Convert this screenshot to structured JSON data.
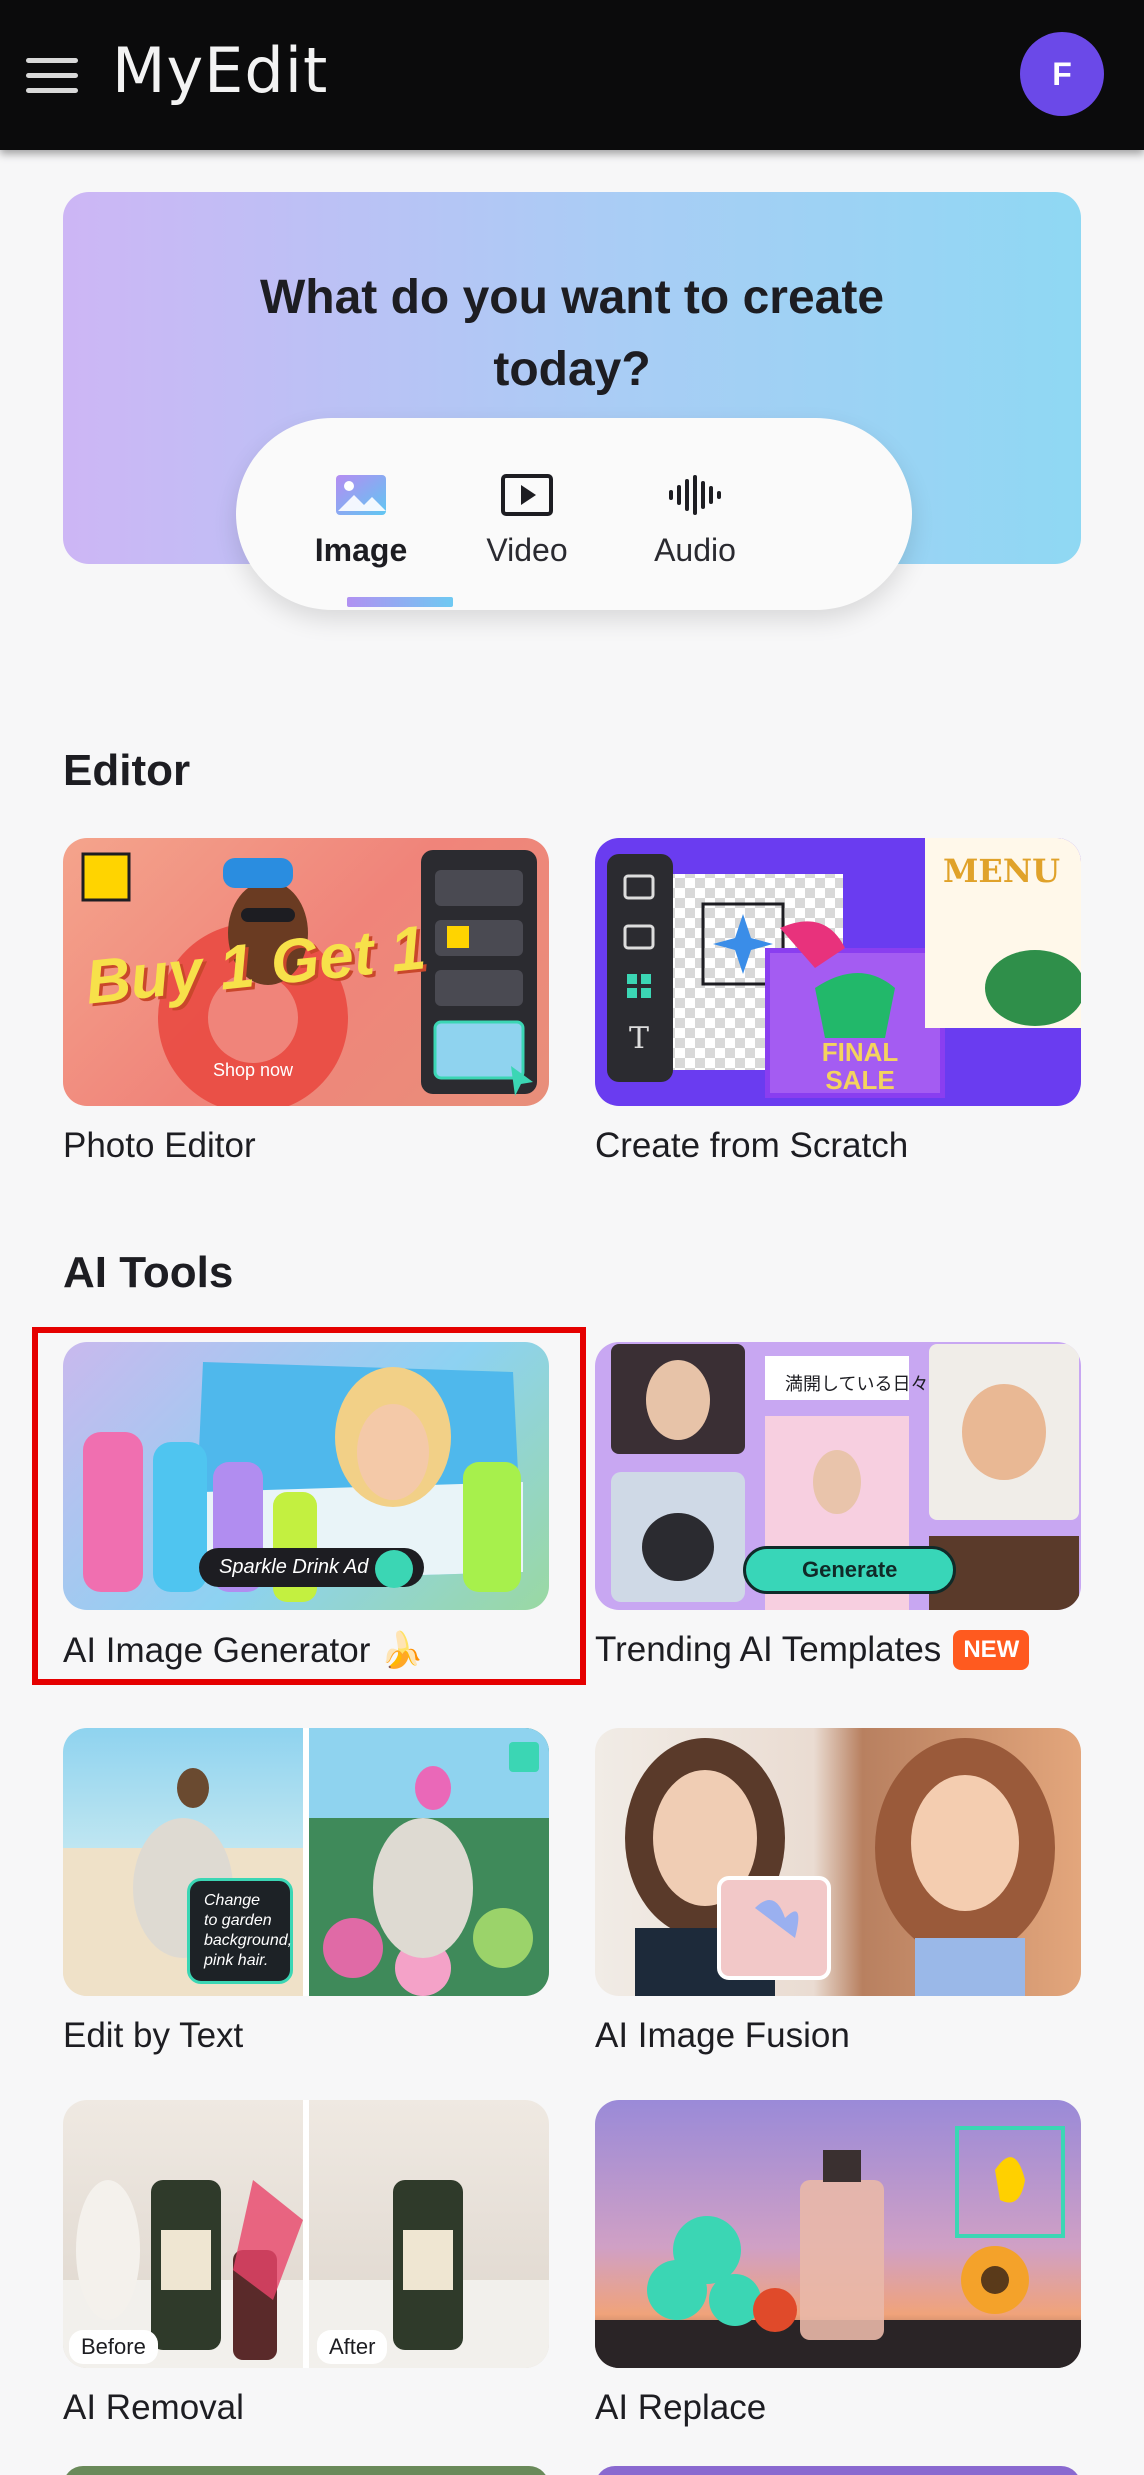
{
  "header": {
    "app_name": "MyEdit",
    "avatar_letter": "F"
  },
  "hero": {
    "title_line1": "What do you want to create",
    "title_line2": "today?",
    "tabs": [
      {
        "label": "Image",
        "icon": "image-icon",
        "active": true
      },
      {
        "label": "Video",
        "icon": "video-icon",
        "active": false
      },
      {
        "label": "Audio",
        "icon": "audio-icon",
        "active": false
      }
    ]
  },
  "editor": {
    "title": "Editor",
    "cards": [
      {
        "label": "Photo Editor"
      },
      {
        "label": "Create from Scratch"
      }
    ]
  },
  "ai_tools": {
    "title": "AI Tools",
    "cards": [
      {
        "label": "AI Image Generator 🍌"
      },
      {
        "label": "Trending AI Templates",
        "badge": "NEW"
      },
      {
        "label": "Edit by Text"
      },
      {
        "label": "AI Image Fusion"
      },
      {
        "label": "AI Removal"
      },
      {
        "label": "AI Replace"
      }
    ]
  },
  "thumb_text": {
    "photo_headline": "Buy 1 Get 1",
    "photo_small": "Shop now",
    "scratch_menu": "MENU",
    "scratch_sale": "FINAL SALE",
    "aigen_prompt": "Sparkle Drink Ad",
    "trend_generate": "Generate",
    "edit_prompt": "Change to garden background, pink hair.",
    "removal_before": "Before",
    "removal_after": "After"
  },
  "colors": {
    "header_bg": "#0b0b0c",
    "avatar_bg": "#6b49e8",
    "new_badge": "#ff5a1f",
    "highlight": "#e50000"
  }
}
